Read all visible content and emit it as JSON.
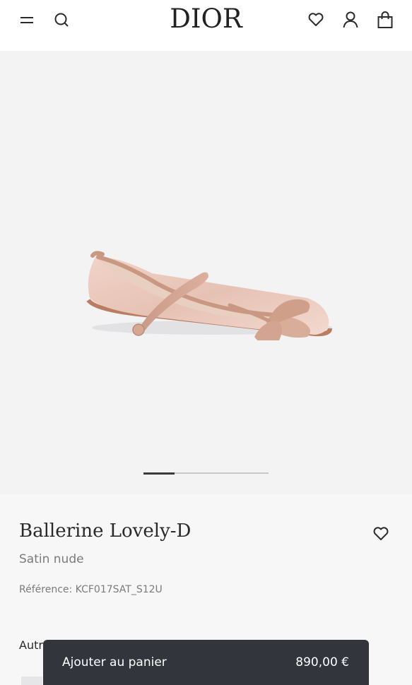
{
  "header": {
    "logo": "DIOR",
    "icons": [
      "menu-icon",
      "search-icon",
      "heart-icon",
      "account-icon",
      "bag-icon"
    ]
  },
  "gallery": {
    "image_count_indicator": "slide 1",
    "progress": 0.25
  },
  "product": {
    "title": "Ballerine Lovely-D",
    "subtitle": "Satin nude",
    "reference": "Référence: KCF017SAT_S12U",
    "other_label": "Autr"
  },
  "cart": {
    "label": "Ajouter au panier",
    "price": "890,00 €"
  },
  "colors": {
    "background_gallery": "#f3f3f4",
    "details_background": "#f7f7f8",
    "cart_bar": "#33353d",
    "shoe_satin": "#e9cbbf"
  }
}
